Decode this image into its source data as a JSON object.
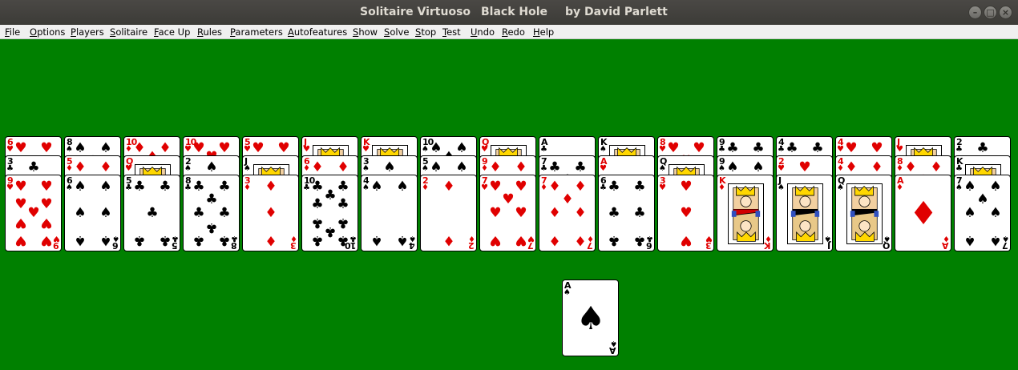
{
  "window": {
    "title_app": "Solitaire Virtuoso",
    "title_game": "Black Hole",
    "title_author": "by David Parlett"
  },
  "menu": [
    "File",
    "Options",
    "Players",
    "Solitaire",
    "Face Up",
    "Rules",
    "Parameters",
    "Autofeatures",
    "Show",
    "Solve",
    "Stop",
    "Test",
    "Undo",
    "Redo",
    "Help"
  ],
  "colors": {
    "felt": "#008000",
    "red_suit": "#e00000",
    "black_suit": "#000000"
  },
  "tableau": [
    [
      "6♥",
      "3♣",
      "9♥"
    ],
    [
      "8♠",
      "5♦",
      "6♠"
    ],
    [
      "10♦",
      "Q♥",
      "5♣"
    ],
    [
      "10♥",
      "2♠",
      "8♣"
    ],
    [
      "5♥",
      "J♠",
      "3♦"
    ],
    [
      "J♥",
      "6♦",
      "10♣"
    ],
    [
      "K♥",
      "3♠",
      "4♠"
    ],
    [
      "10♠",
      "5♠",
      "2♦"
    ],
    [
      "Q♥",
      "9♦",
      "7♥"
    ],
    [
      "A♣",
      "7♣",
      "7♦"
    ],
    [
      "K♠",
      "A♥",
      "6♣"
    ],
    [
      "8♥",
      "Q♠",
      "3♥"
    ],
    [
      "9♣",
      "9♠",
      "K♦"
    ],
    [
      "4♣",
      "2♥",
      "J♠"
    ],
    [
      "4♥",
      "4♦",
      "Q♠"
    ],
    [
      "J♥",
      "8♦",
      "A♦"
    ],
    [
      "2♣",
      "K♣",
      "7♠"
    ]
  ],
  "black_hole": "A♠"
}
